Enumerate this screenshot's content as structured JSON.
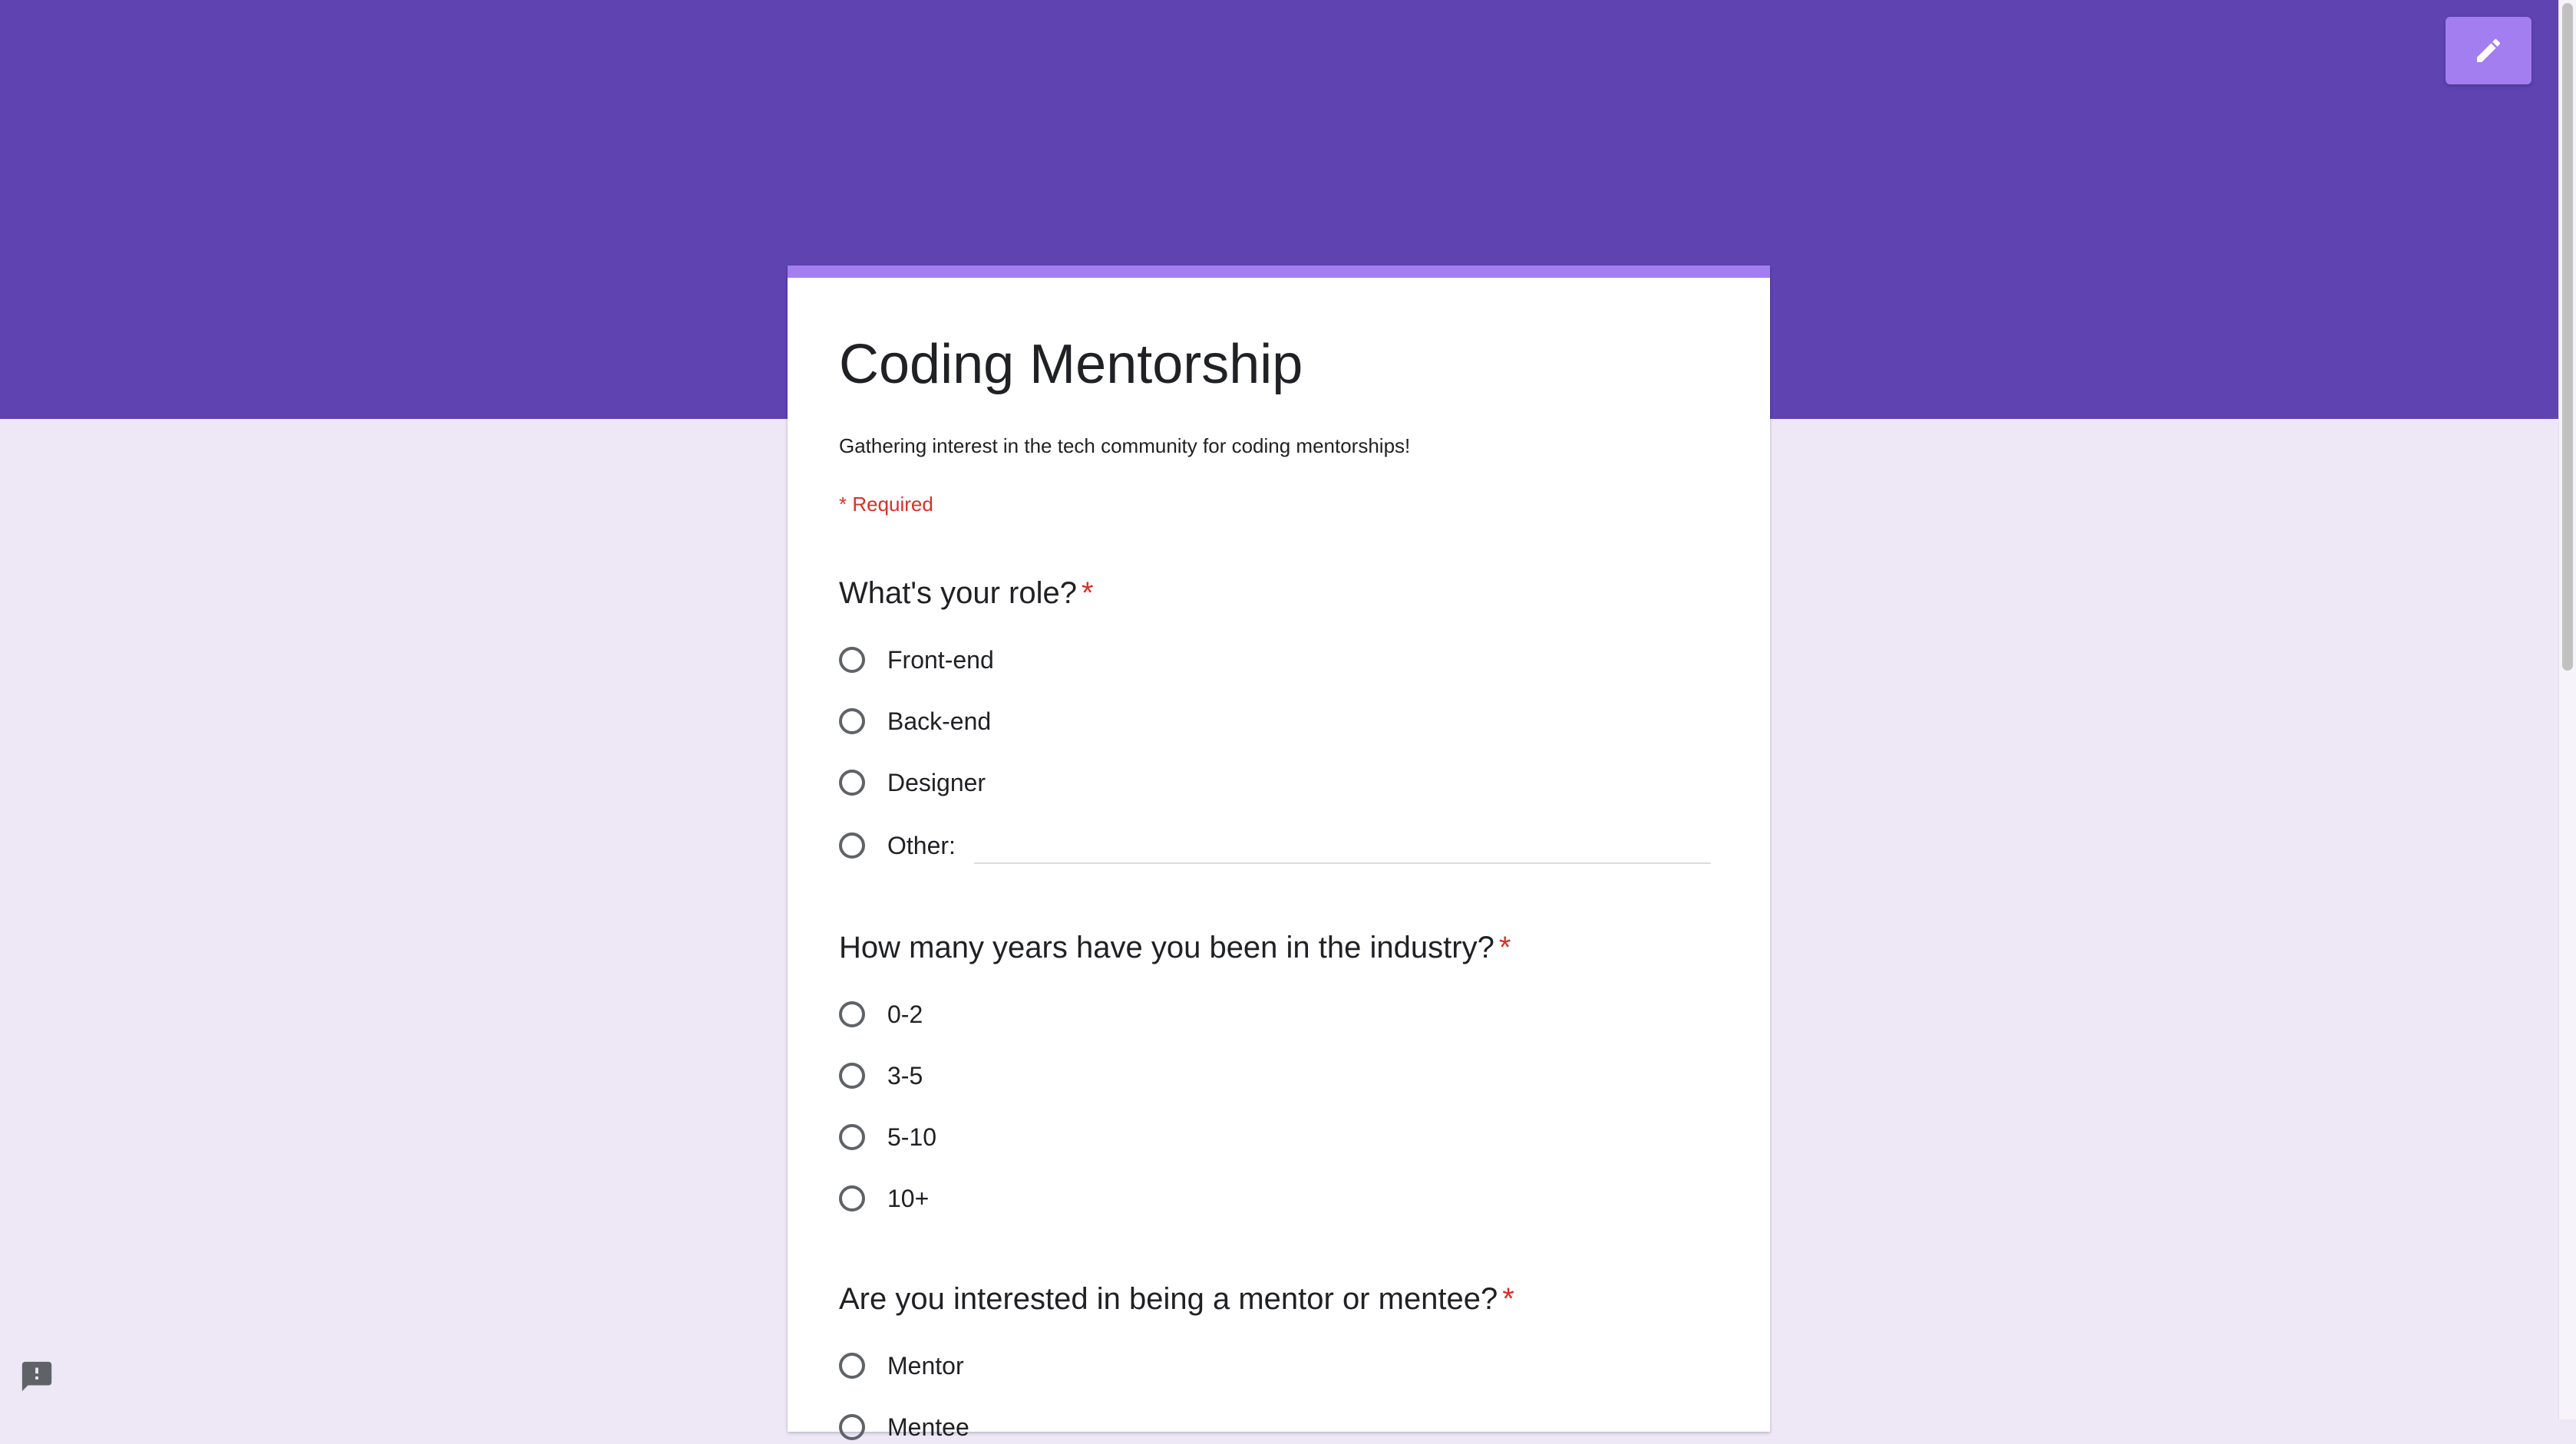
{
  "colors": {
    "header_band": "#5e43b1",
    "accent": "#a27ef0",
    "page_background": "#ede7f6",
    "required": "#d93025",
    "radio_border": "#5f6368"
  },
  "header": {
    "edit_button_icon": "pencil-icon"
  },
  "form": {
    "title": "Coding Mentorship",
    "description": "Gathering interest in the tech community for coding mentorships!",
    "required_note": "* Required",
    "questions": [
      {
        "title": "What's your role?",
        "required_mark": "*",
        "options": [
          "Front-end",
          "Back-end",
          "Designer",
          "Other:"
        ],
        "other_input_value": ""
      },
      {
        "title": "How many years have you been in the industry?",
        "required_mark": "*",
        "options": [
          "0-2",
          "3-5",
          "5-10",
          "10+"
        ]
      },
      {
        "title": "Are you interested in being a mentor or mentee?",
        "required_mark": "*",
        "options": [
          "Mentor",
          "Mentee"
        ]
      }
    ]
  },
  "footer": {
    "feedback_icon": "report-feedback-icon"
  }
}
